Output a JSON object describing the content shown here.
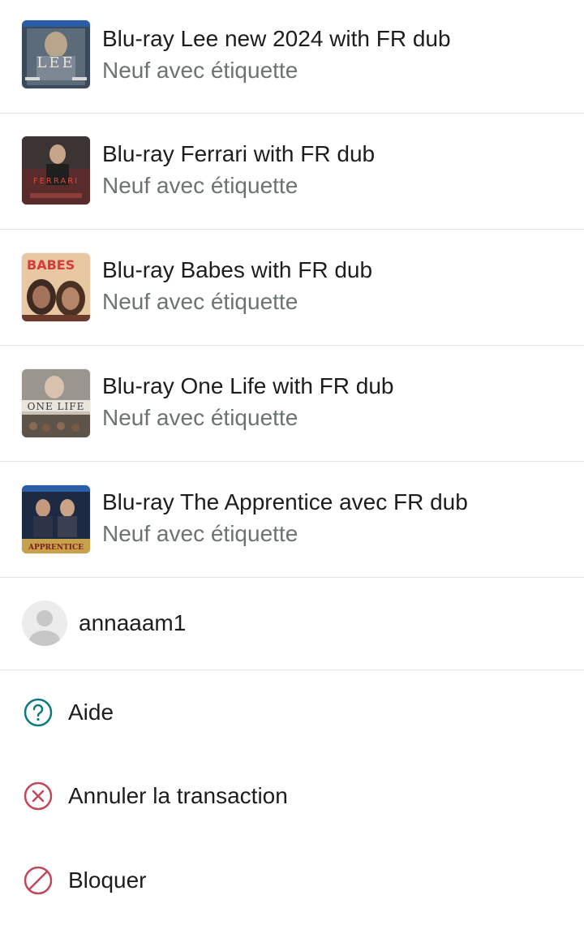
{
  "items": [
    {
      "title": "Blu-ray Lee new 2024 with FR dub",
      "condition": "Neuf avec étiquette",
      "thumb": "lee-cover"
    },
    {
      "title": "Blu-ray Ferrari with FR dub",
      "condition": "Neuf avec étiquette",
      "thumb": "ferrari-cover"
    },
    {
      "title": "Blu-ray Babes with FR dub",
      "condition": "Neuf avec étiquette",
      "thumb": "babes-cover"
    },
    {
      "title": "Blu-ray One Life with FR dub",
      "condition": "Neuf avec étiquette",
      "thumb": "one-life-cover"
    },
    {
      "title": "Blu-ray The Apprentice avec FR dub",
      "condition": "Neuf avec étiquette",
      "thumb": "apprentice-cover"
    }
  ],
  "thumb_text": {
    "lee": "LEE",
    "ferrari": "FERRARI",
    "babes": "BABES",
    "one_life": "ONE LIFE",
    "apprentice": "APPRENTICE"
  },
  "user": {
    "name": "annaaam1",
    "avatar_icon": "default-avatar-icon"
  },
  "actions": {
    "help": {
      "label": "Aide",
      "icon": "help-icon",
      "color": "#0f7a7d"
    },
    "cancel": {
      "label": "Annuler la transaction",
      "icon": "cancel-circle-icon",
      "color": "#c0485a"
    },
    "block": {
      "label": "Bloquer",
      "icon": "block-icon",
      "color": "#c0485a"
    }
  }
}
